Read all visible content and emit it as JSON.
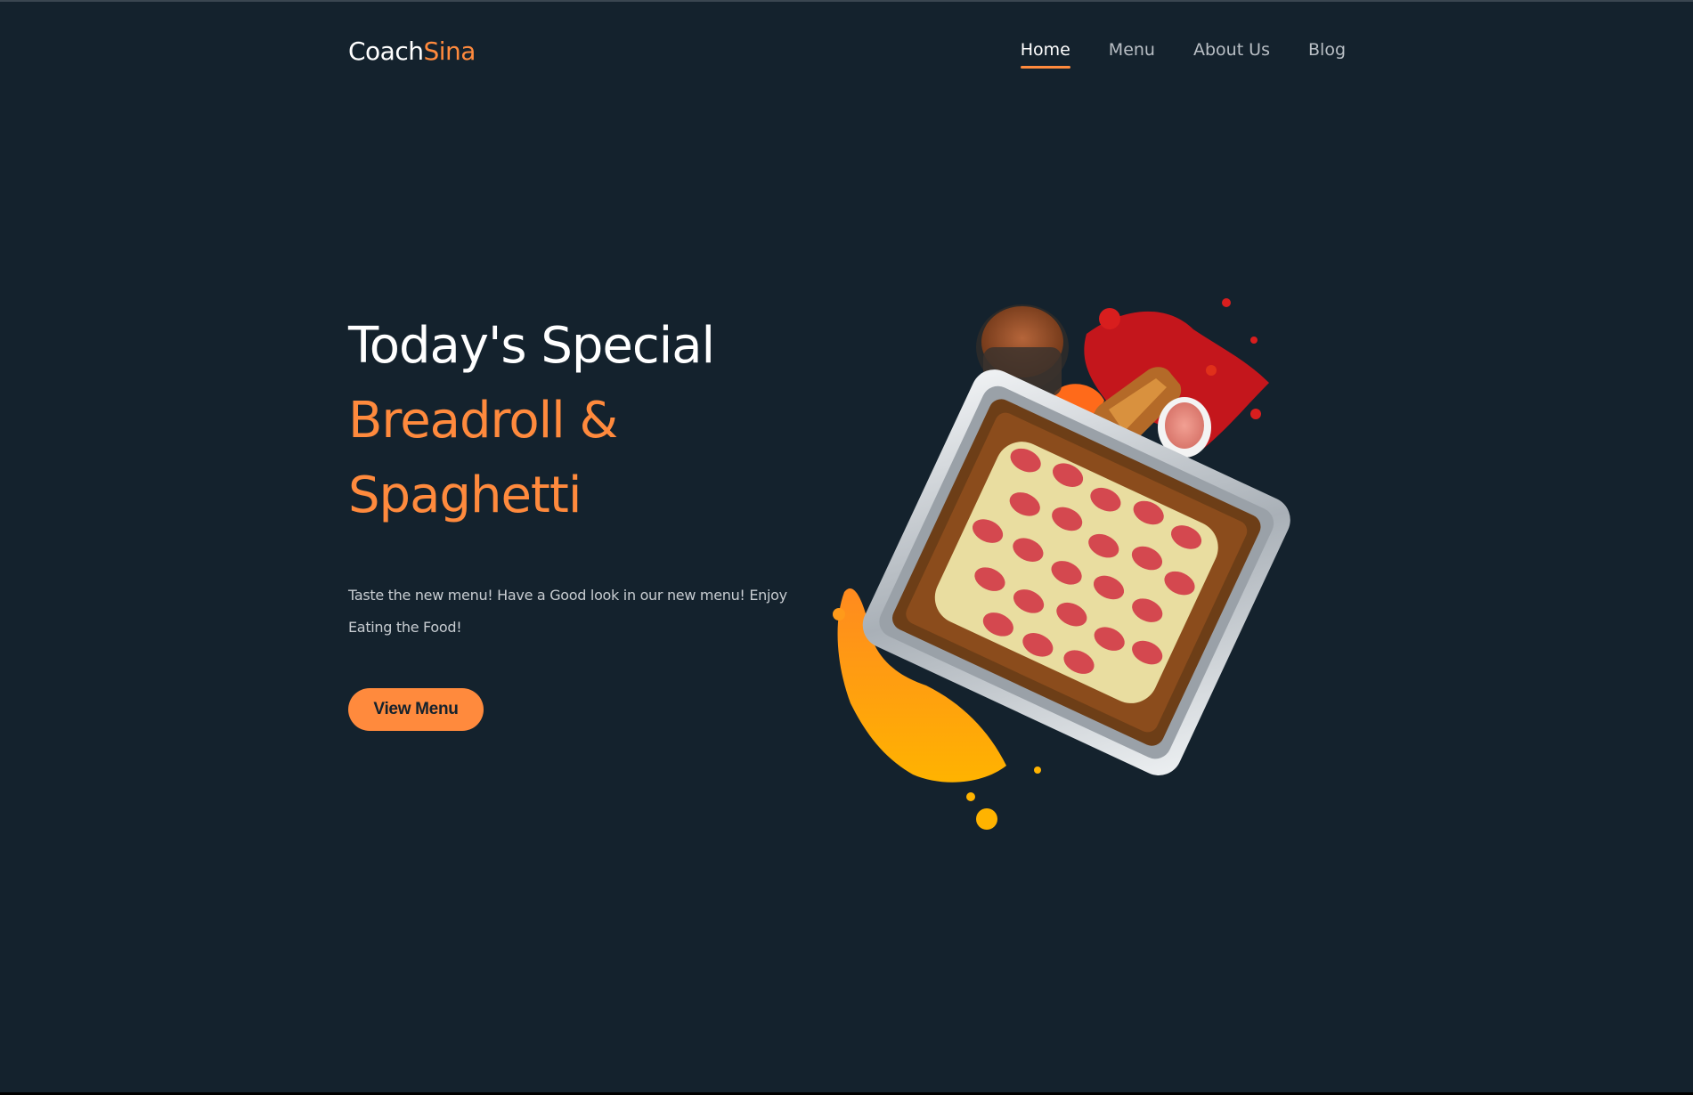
{
  "brand": {
    "name_part1": "Coach",
    "name_part2": "Sina",
    "accent_color": "#ff8a3d",
    "background_color": "#14222d"
  },
  "nav": {
    "items": [
      {
        "label": "Home",
        "active": true
      },
      {
        "label": "Menu",
        "active": false
      },
      {
        "label": "About Us",
        "active": false
      },
      {
        "label": "Blog",
        "active": false
      }
    ]
  },
  "hero": {
    "title": "Today's Special",
    "subtitle": "Breadroll & Spaghetti",
    "description": "Taste the new menu! Have a Good look in our new menu! Enjoy Eating the Food!",
    "cta_label": "View Menu",
    "image_icon": "food-tray-illustration"
  }
}
